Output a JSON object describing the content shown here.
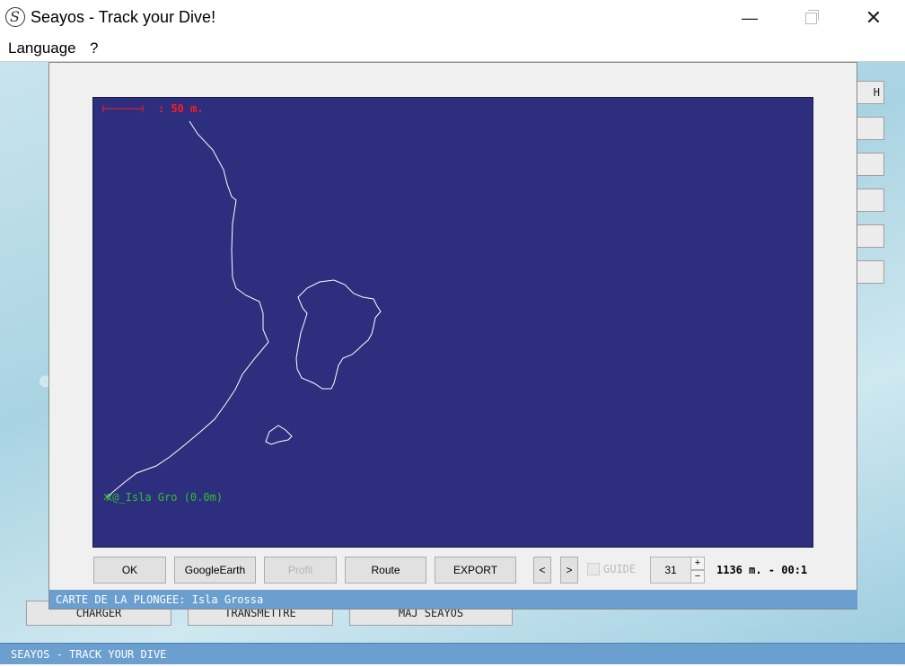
{
  "window": {
    "title": "Seayos - Track your Dive!",
    "icon": "seayos-logo-icon",
    "controls": {
      "minimize": "—",
      "restore": "restore-icon",
      "close": "✕"
    }
  },
  "menu": {
    "items": [
      "Language",
      "?"
    ]
  },
  "background": {
    "buttons": [
      "CHARGER",
      "TRANSMETTRE",
      "MAJ SEAYOS"
    ],
    "side_buttons": [
      "H",
      "",
      "",
      "",
      "",
      ""
    ]
  },
  "dialog": {
    "map": {
      "background_color": "#2e2e7e",
      "scale_label": ": 50 m.",
      "marker_label": "x@_Isla Gro (0.0m)",
      "scale_color": "#ff1a1a",
      "marker_color": "#2fbf2f"
    },
    "buttons": {
      "ok": "OK",
      "google_earth": "GoogleEarth",
      "profil": "Profil",
      "route": "Route",
      "export": "EXPORT",
      "prev": "<",
      "next": ">"
    },
    "guide_label": "GUIDE",
    "spinner": {
      "value": "31",
      "up": "+",
      "down": "−"
    },
    "readout": "1136 m. - 00:1",
    "status": "CARTE DE LA PLONGEE: Isla Grossa"
  },
  "app_status": "SEAYOS - TRACK YOUR DIVE"
}
